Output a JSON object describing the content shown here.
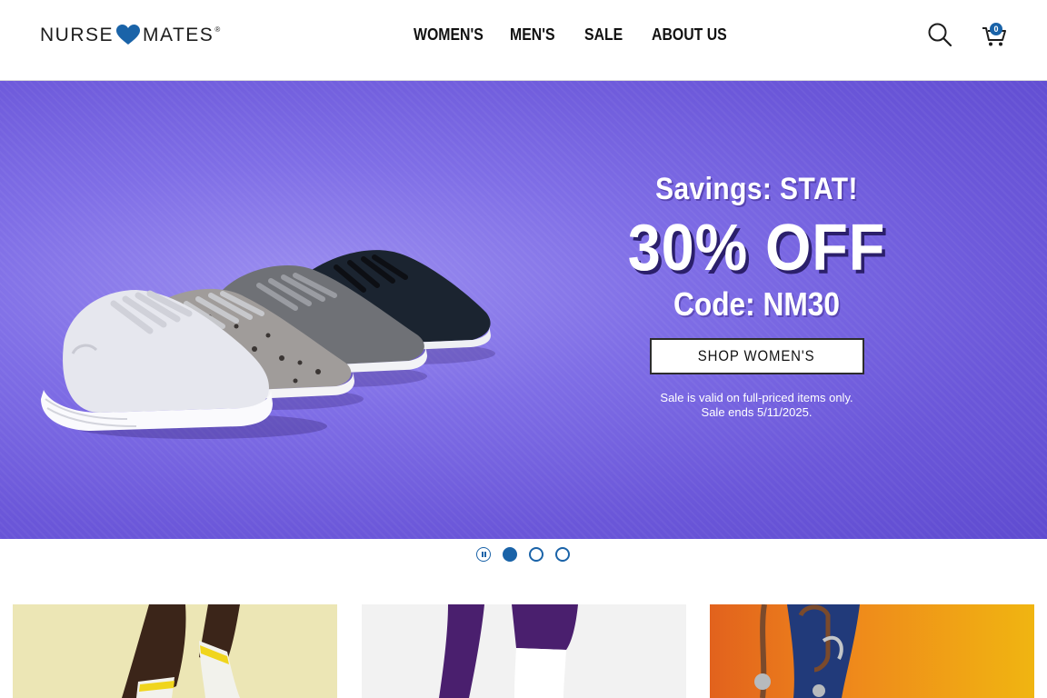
{
  "header": {
    "logo": {
      "left": "NURSE",
      "right": "MATES",
      "registered": "®",
      "heart_color": "#1a63a8"
    },
    "nav": [
      {
        "label": "WOMEN'S"
      },
      {
        "label": "MEN'S"
      },
      {
        "label": "SALE"
      },
      {
        "label": "ABOUT US"
      }
    ],
    "search_icon": "search-icon",
    "cart": {
      "icon": "cart-icon",
      "count": "0"
    }
  },
  "hero": {
    "eyebrow": "Savings: STAT!",
    "headline": "30% OFF",
    "code": "Code: NM30",
    "cta": "SHOP WOMEN'S",
    "fine_print_1": "Sale is valid on full-priced items only.",
    "fine_print_2": "Sale ends 5/11/2025.",
    "background_color": "#7f6ee6"
  },
  "carousel": {
    "pause_icon": "pause-icon",
    "slides": 3,
    "active_index": 1,
    "accent": "#1a63a8"
  },
  "cards": [
    {
      "name": "socks-yellow",
      "color": "#ece6b5"
    },
    {
      "name": "socks-purple-scrubs",
      "color": "#f2f2f2"
    },
    {
      "name": "stethoscope-orange",
      "color": "#ef8a1b"
    }
  ]
}
